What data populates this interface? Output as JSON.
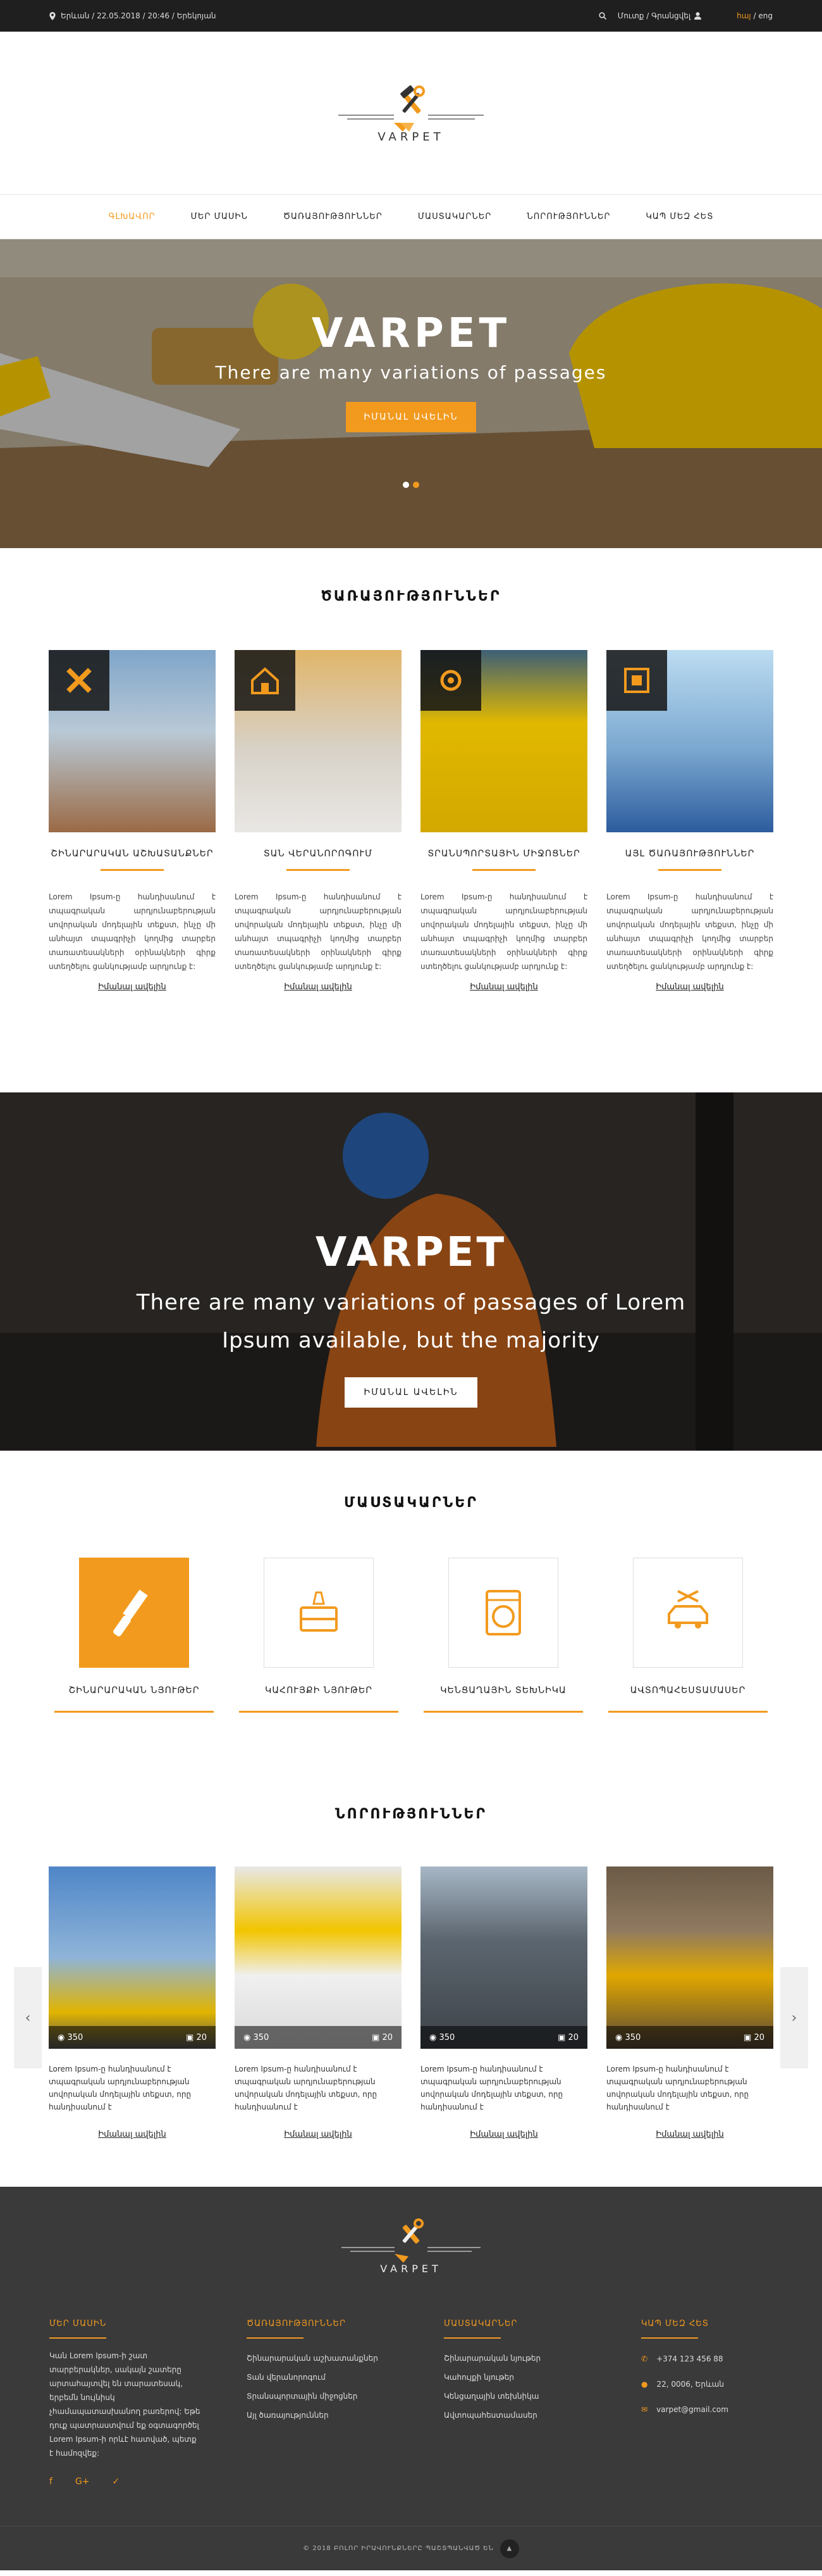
{
  "topbar": {
    "location": "Երևան / 22.05.2018 / 20:46 / Երեկոյան",
    "auth": "Մուտք / Գրանցվել",
    "lang_hy": "հայ",
    "lang_sep": "/",
    "lang_en": "eng"
  },
  "header": {
    "brand": "VARPET"
  },
  "nav": {
    "items": [
      {
        "label": "ԳԼԽԱՎՈՐ",
        "active": true
      },
      {
        "label": "ՄԵՐ ՄԱՍԻՆ"
      },
      {
        "label": "ԾԱՌԱՅՈՒԹՅՈՒՆՆԵՐ"
      },
      {
        "label": "ՄԱՍՏԱԿԱՐՆԵՐ"
      },
      {
        "label": "ՆՈՐՈՒԹՅՈՒՆՆԵՐ"
      },
      {
        "label": "ԿԱՊ ՄԵԶ ՀԵՏ"
      }
    ]
  },
  "hero": {
    "title": "VARPET",
    "subtitle": "There are many variations of passages",
    "button": "ԻՄԱՆԱԼ ԱՎԵԼԻՆ"
  },
  "services": {
    "title": "ԾԱՌԱՅՈՒԹՅՈՒՆՆԵՐ",
    "cards": [
      {
        "title": "ՇԻՆԱՐԱՐԱԿԱՆ ԱՇԽԱՏԱՆՔՆԵՐ",
        "text": "Lorem Ipsum-ը հանդիսանում է տպագրական արդյունաբերության սովորական մոդելային տեքստ, ինչը մի անհայտ տպագրիչի կողմից տարբեր տառատեսակների օրինակների գիրք ստեղծելու ցանկությամբ արդյունք է:",
        "more": "Իմանալ ավելին"
      },
      {
        "title": "ՏԱՆ ՎԵՐԱՆՈՐՈԳՈՒՄ",
        "text": "Lorem Ipsum-ը հանդիսանում է տպագրական արդյունաբերության սովորական մոդելային տեքստ, ինչը մի անհայտ տպագրիչի կողմից տարբեր տառատեսակների օրինակների գիրք ստեղծելու ցանկությամբ արդյունք է:",
        "more": "Իմանալ ավելին"
      },
      {
        "title": "ՏՐԱՆՍՊՈՐՏԱՅԻՆ ՄԻՋՈՑՆԵՐ",
        "text": "Lorem Ipsum-ը հանդիսանում է տպագրական արդյունաբերության սովորական մոդելային տեքստ, ինչը մի անհայտ տպագրիչի կողմից տարբեր տառատեսակների օրինակների գիրք ստեղծելու ցանկությամբ արդյունք է:",
        "more": "Իմանալ ավելին"
      },
      {
        "title": "ԱՅԼ ԾԱՌԱՅՈՒԹՅՈՒՆՆԵՐ",
        "text": "Lorem Ipsum-ը հանդիսանում է տպագրական արդյունաբերության սովորական մոդելային տեքստ, ինչը մի անհայտ տպագրիչի կողմից տարբեր տառատեսակների օրինակների գիրք ստեղծելու ցանկությամբ արդյունք է:",
        "more": "Իմանալ ավելին"
      }
    ]
  },
  "banner": {
    "title": "VARPET",
    "subtitle_line1": "There are many variations of passages of Lorem",
    "subtitle_line2": "Ipsum available, but the majority",
    "button": "ԻՄԱՆԱԼ ԱՎԵԼԻՆ"
  },
  "masters": {
    "title": "ՄԱՍՏԱԿԱՐՆԵՐ",
    "cards": [
      {
        "title": "ՇԻՆԱՐԱՐԱԿԱՆ ՆՅՈՒԹԵՐ",
        "icon": "paint-brush-icon"
      },
      {
        "title": "ԿԱՀՈՒՅՔԻ ՆՅՈՒԹԵՐ",
        "icon": "furniture-icon"
      },
      {
        "title": "ԿԵՆՑԱՂԱՅԻՆ ՏԵԽՆԻԿԱ",
        "icon": "washing-machine-icon"
      },
      {
        "title": "ԱՎՏՈՊԱՀԵՍՏԱՄԱՍԵՐ",
        "icon": "car-service-icon"
      }
    ]
  },
  "news": {
    "title": "ՆՈՐՈՒԹՅՈՒՆՆԵՐ",
    "cards": [
      {
        "views": "350",
        "comments": "20",
        "text": "Lorem Ipsum-ը հանդիսանում է տպագրական արդյունաբերության սովորական մոդելային տեքստ, որը հանդիսանում է",
        "more": "Իմանալ ավելին"
      },
      {
        "views": "350",
        "comments": "20",
        "text": "Lorem Ipsum-ը հանդիսանում է տպագրական արդյունաբերության սովորական մոդելային տեքստ, որը հանդիսանում է",
        "more": "Իմանալ ավելին"
      },
      {
        "views": "350",
        "comments": "20",
        "text": "Lorem Ipsum-ը հանդիսանում է տպագրական արդյունաբերության սովորական մոդելային տեքստ, որը հանդիսանում է",
        "more": "Իմանալ ավելին"
      },
      {
        "views": "350",
        "comments": "20",
        "text": "Lorem Ipsum-ը հանդիսանում է տպագրական արդյունաբերության սովորական մոդելային տեքստ, որը հանդիսանում է",
        "more": "Իմանալ ավելին"
      }
    ]
  },
  "footer": {
    "brand": "VARPET",
    "about": {
      "title": "ՄԵՐ ՄԱՍԻՆ",
      "text": "Կան Lorem Ipsum-ի շատ տարբերակներ, սակայն շատերը արտահայտվել են տարատեսակ, երբեմն նույնիսկ չհամապատասխանող բառերով: Եթե դուք պատրաստվում եք օգտագործել Lorem Ipsum-ի որևէ հատված, պետք է համոզվեք:"
    },
    "services": {
      "title": "ԾԱՌԱՅՈՒԹՅՈՒՆՆԵՐ",
      "items": [
        "Շինարարական աշխատանքներ",
        "Տան վերանորոգում",
        "Տրանսպորտային միջոցներ",
        "Այլ ծառայություններ"
      ]
    },
    "masters": {
      "title": "ՄԱՍՏԱԿԱՐՆԵՐ",
      "items": [
        "Շինարարական նյութեր",
        "Կահույքի նյութեր",
        "Կենցաղային տեխնիկա",
        "Ավտոպահեստամասեր"
      ]
    },
    "contact": {
      "title": "ԿԱՊ ՄԵԶ ՀԵՏ",
      "phone": "+374 123 456 88",
      "address": "22, 0006, Երևան",
      "email": "varpet@gmail.com"
    },
    "copyright": "© 2018 ԲՈԼՈՐ ԻՐԱՎՈՒՆՔՆԵՐԸ ՊԱՇՏՊԱՆՎԱԾ ԵՆ"
  },
  "colors": {
    "accent": "#f29a1e",
    "dark": "#1f1f1f",
    "footer": "#3a3a3a"
  }
}
